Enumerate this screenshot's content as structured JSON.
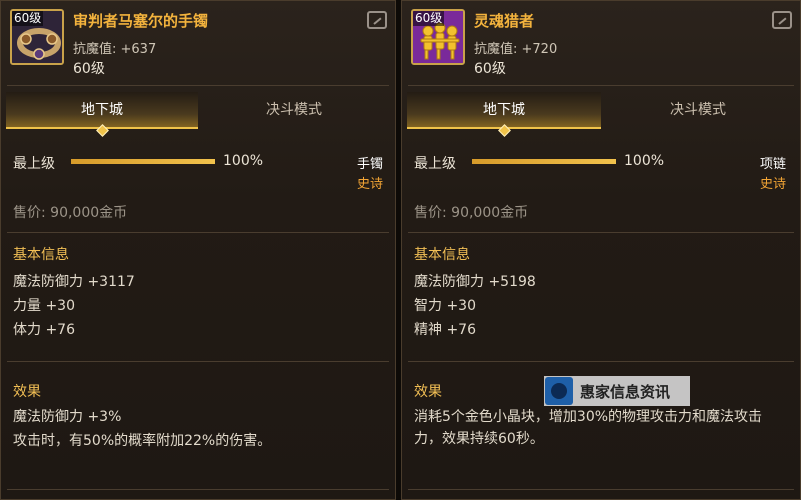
{
  "left": {
    "level_tag": "60级",
    "name": "审判者马塞尔的手镯",
    "stat": "抗魔值: +637",
    "level": "60级",
    "tabs": [
      "地下城",
      "决斗模式"
    ],
    "max_label": "最上级",
    "progress": 1.0,
    "progress_text": "100%",
    "slot": "手镯",
    "rarity": "史诗",
    "price": "售价: 90,000金币",
    "basic_title": "基本信息",
    "attrs": [
      "魔法防御力 +3117",
      "力量 +30",
      "体力 +76"
    ],
    "effect_title": "效果",
    "effects": [
      "魔法防御力 +3%",
      "攻击时，有50%的概率附加22%的伤害。"
    ]
  },
  "right": {
    "level_tag": "60级",
    "name": "灵魂猎者",
    "stat": "抗魔值: +720",
    "level": "60级",
    "tabs": [
      "地下城",
      "决斗模式"
    ],
    "max_label": "最上级",
    "progress": 1.0,
    "progress_text": "100%",
    "slot": "项链",
    "rarity": "史诗",
    "price": "售价: 90,000金币",
    "basic_title": "基本信息",
    "attrs": [
      "魔法防御力 +5198",
      "智力 +30",
      "精神 +76"
    ],
    "effect_title": "效果",
    "effects": [
      "消耗5个金色小晶块，增加30%的物理攻击力和魔法攻击力，效果持续60秒。"
    ]
  },
  "watermark": {
    "text": "惠家信息资讯"
  },
  "colors": {
    "item_name": "#f3b33d",
    "rarity": "#f3a535",
    "section": "#f2bf55",
    "tab_accent": "#f0c34a"
  }
}
